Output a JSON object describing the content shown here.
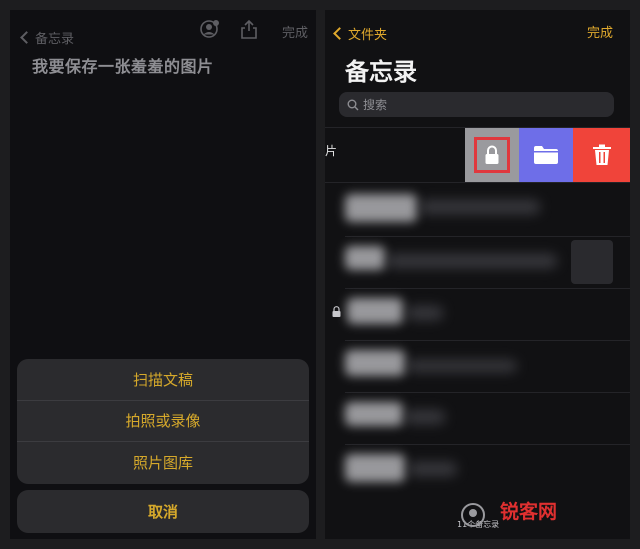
{
  "left": {
    "back_label": "备忘录",
    "done_label": "完成",
    "note_title": "我要保存一张羞羞的图片",
    "sheet": {
      "items": [
        "扫描文稿",
        "拍照或录像",
        "照片图库"
      ],
      "cancel": "取消"
    }
  },
  "right": {
    "back_label": "文件夹",
    "done_label": "完成",
    "title": "备忘录",
    "search_placeholder": "搜索",
    "partial_row_text": "片",
    "footer_count": "11个备忘录"
  },
  "colors": {
    "accent": "#e0a92d",
    "lock_action": "#9a9a9e",
    "move_action": "#6e6ee8",
    "delete_action": "#f0443a",
    "highlight": "#e0383e"
  },
  "icons": [
    "person-icon",
    "share-icon",
    "chevron-left-icon",
    "search-icon",
    "lock-icon",
    "folder-icon",
    "trash-icon"
  ],
  "watermark": "锐客网"
}
